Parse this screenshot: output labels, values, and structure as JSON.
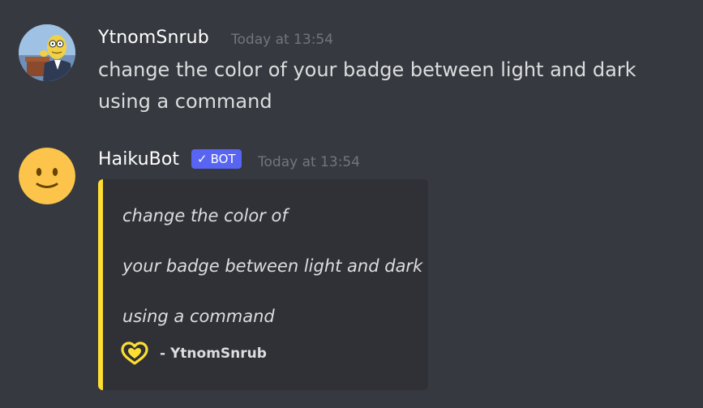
{
  "messages": [
    {
      "author": "YtnomSnrub",
      "timestamp": "Today at 13:54",
      "avatar": "mr-burns-avatar",
      "text": "change the color of your badge between light and dark using a command"
    },
    {
      "author": "HaikuBot",
      "bot_tag": "BOT",
      "bot_check": "✓",
      "timestamp": "Today at 13:54",
      "avatar": "slightly-smiling-face-avatar",
      "embed": {
        "accent_color": "#fdde31",
        "lines": [
          "change the color of",
          "your badge between light and dark",
          "using a command"
        ],
        "footer_icon": "yellow-heart-badge-icon",
        "footer_author": "- YtnomSnrub"
      }
    }
  ],
  "colors": {
    "background": "#36393f",
    "embed_background": "#2f3136",
    "bot_tag": "#5865f2",
    "timestamp": "#72767d",
    "text": "#dcddde"
  }
}
